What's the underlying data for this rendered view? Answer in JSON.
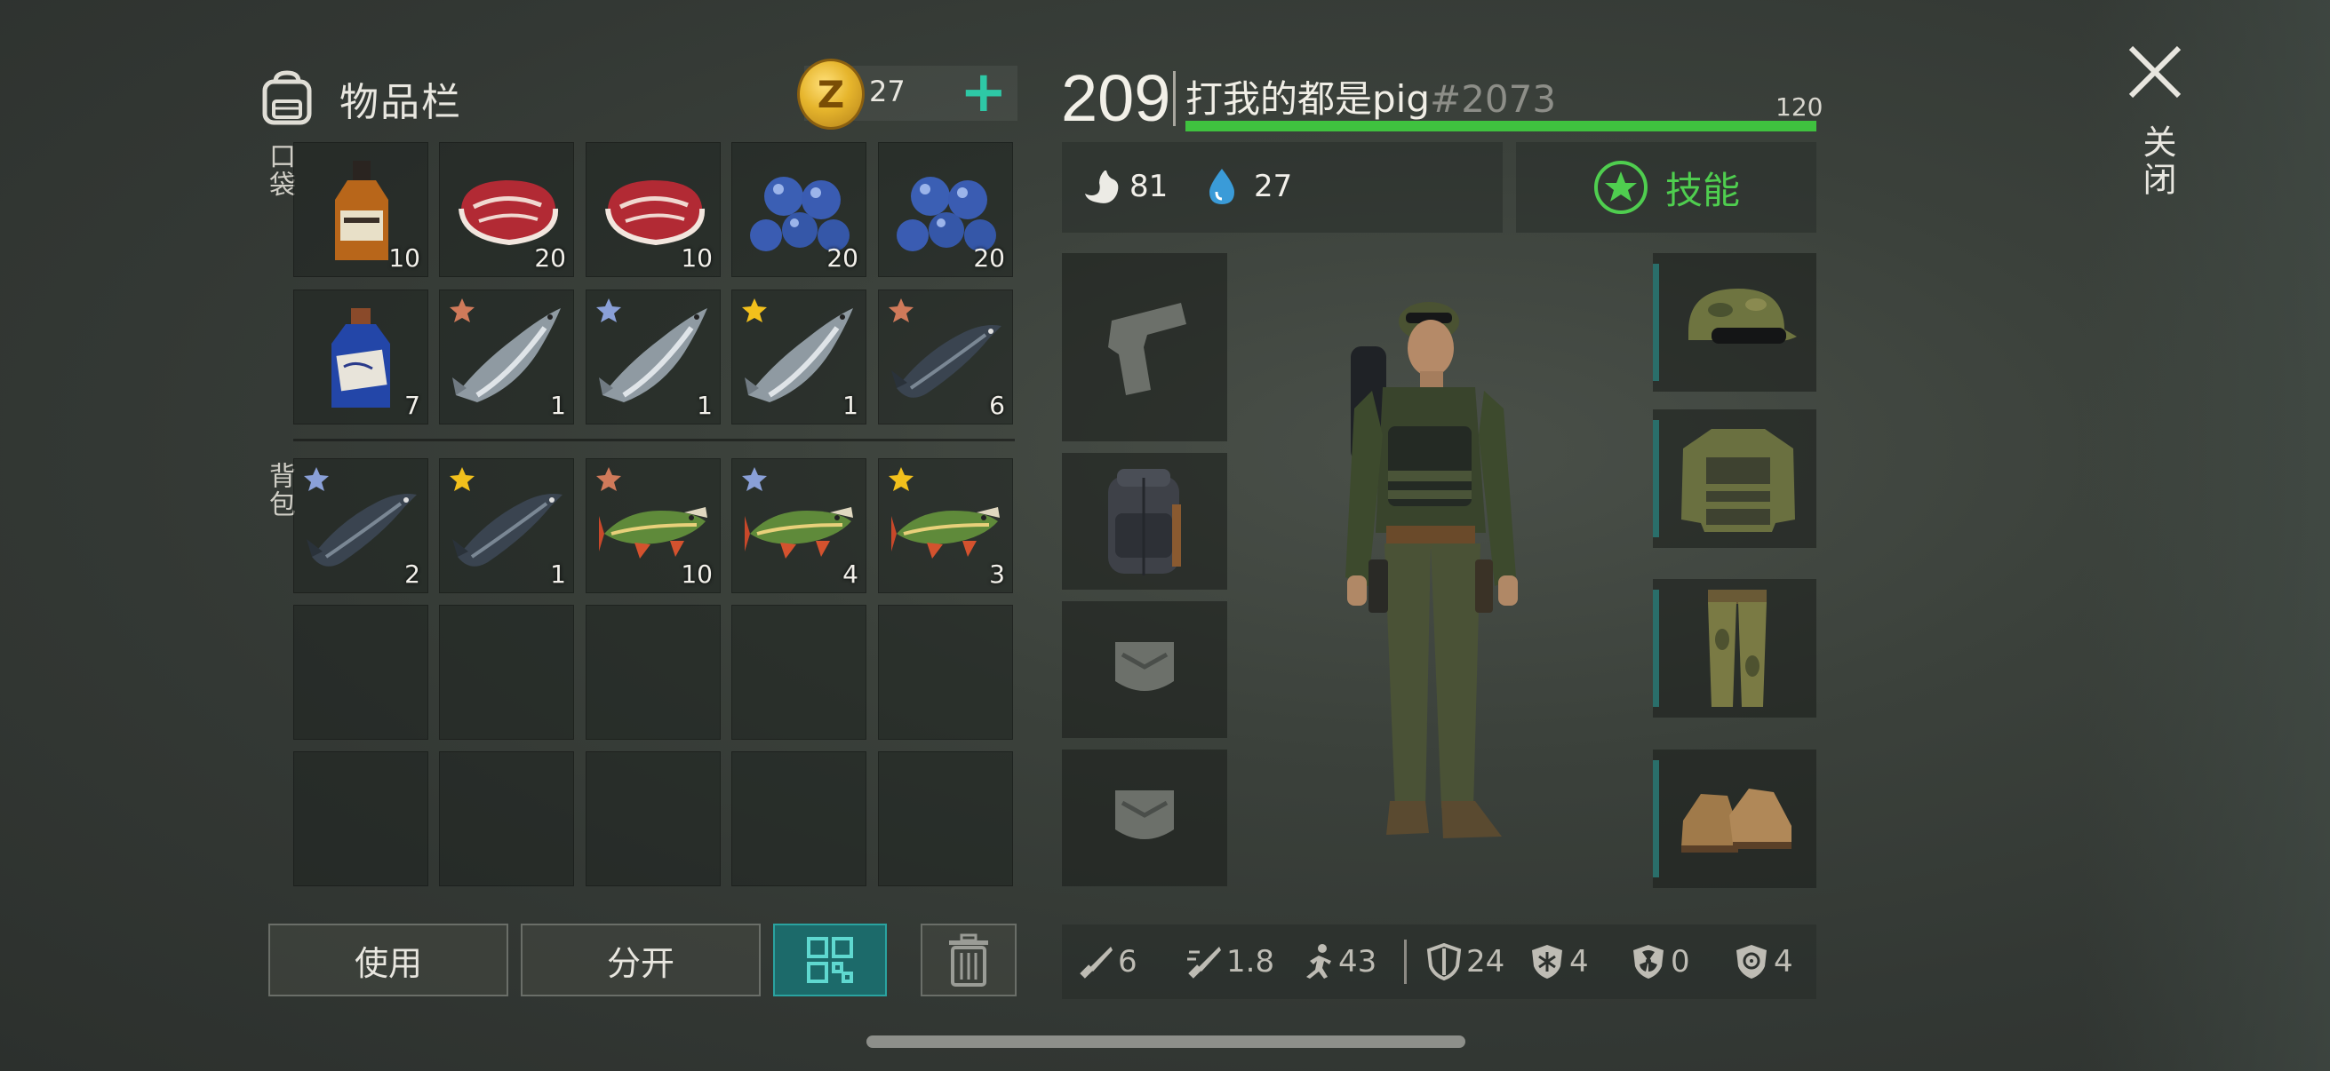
{
  "inventory": {
    "title": "物品栏",
    "coins": "27",
    "add_label": "+",
    "pocket_label": "口袋",
    "backpack_label": "背包",
    "pocket_slots": [
      {
        "item": "whiskey-bottle",
        "qty": "10",
        "star": ""
      },
      {
        "item": "raw-meat",
        "qty": "20",
        "star": ""
      },
      {
        "item": "raw-meat",
        "qty": "10",
        "star": ""
      },
      {
        "item": "blueberries",
        "qty": "20",
        "star": ""
      },
      {
        "item": "blueberries",
        "qty": "20",
        "star": ""
      },
      {
        "item": "blue-potion-bottle",
        "qty": "7",
        "star": ""
      },
      {
        "item": "salmon",
        "qty": "1",
        "star": "bronze"
      },
      {
        "item": "salmon",
        "qty": "1",
        "star": "silver"
      },
      {
        "item": "salmon",
        "qty": "1",
        "star": "gold"
      },
      {
        "item": "sturgeon",
        "qty": "6",
        "star": "bronze"
      }
    ],
    "backpack_slots": [
      {
        "item": "sturgeon",
        "qty": "2",
        "star": "silver"
      },
      {
        "item": "sturgeon",
        "qty": "1",
        "star": "gold"
      },
      {
        "item": "pike",
        "qty": "10",
        "star": "bronze"
      },
      {
        "item": "pike",
        "qty": "4",
        "star": "silver"
      },
      {
        "item": "pike",
        "qty": "3",
        "star": "gold"
      }
    ],
    "empty_slot_count": 10,
    "buttons": {
      "use": "使用",
      "split": "分开"
    }
  },
  "character": {
    "level": "209",
    "name": "打我的都是pig",
    "tag": "#2073",
    "xp_max": "120",
    "xp_progress": 1.0,
    "food": "81",
    "water": "27",
    "skills_label": "技能",
    "equipment_slots": [
      "pistol-icon",
      "backpack-icon",
      "pocket-icon",
      "pocket-icon"
    ],
    "gear_slots": [
      "camo-cap-with-goggles",
      "camo-vest",
      "camo-pants",
      "leather-boots"
    ]
  },
  "stats": {
    "melee_damage": "6",
    "attack_speed": "1.8",
    "move_speed": "43",
    "armor": "24",
    "cold_resistance": "4",
    "radiation_resistance": "0",
    "infection_resistance": "4"
  },
  "window": {
    "close_label": "关闭"
  },
  "colors": {
    "accent": "#2ec8a6",
    "xp_bar": "#3fc23f",
    "skill": "#4fce4f",
    "star_bronze": "#d07a5a",
    "star_silver": "#8aa0d8",
    "star_gold": "#f2c01c"
  }
}
